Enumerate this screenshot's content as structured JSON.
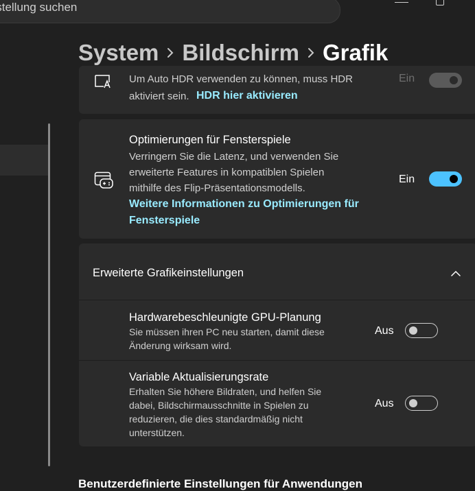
{
  "search": {
    "text": "instellung suchen"
  },
  "breadcrumb": [
    "System",
    "Bildschirm",
    "Grafik"
  ],
  "hdr": {
    "desc_line1": "Um Auto HDR verwenden zu können, muss HDR",
    "desc_line2": "aktiviert sein.",
    "link": "HDR hier aktivieren",
    "state": "Ein"
  },
  "optim": {
    "title": "Optimierungen für Fensterspiele",
    "desc_lines": [
      "Verringern Sie die Latenz, und verwenden Sie",
      "erweiterte Features in kompatiblen Spielen",
      "mithilfe des Flip-Präsentationsmodells."
    ],
    "link_lines": [
      "Weitere Informationen zu Optimierungen für",
      "Fensterspiele"
    ],
    "state": "Ein"
  },
  "advanced": {
    "header": "Erweiterte Grafikeinstellungen",
    "gpu": {
      "title": "Hardwarebeschleunigte GPU-Planung",
      "desc_lines": [
        "Sie müssen ihren PC neu starten, damit diese",
        "Änderung wirksam wird."
      ],
      "state": "Aus"
    },
    "vrr": {
      "title": "Variable Aktualisierungsrate",
      "desc_lines": [
        "Erhalten Sie höhere Bildraten, und helfen Sie",
        "dabei, Bildschirmausschnitte in Spielen zu",
        "reduzieren, die dies standardmäßig nicht",
        "unterstützen."
      ],
      "state": "Aus"
    }
  },
  "section": {
    "title": "Benutzerdefinierte Einstellungen für Anwendungen"
  },
  "colors": {
    "accent": "#4cc2ff",
    "link": "#99ebff",
    "card": "#2b2b2b",
    "background": "#202020"
  }
}
